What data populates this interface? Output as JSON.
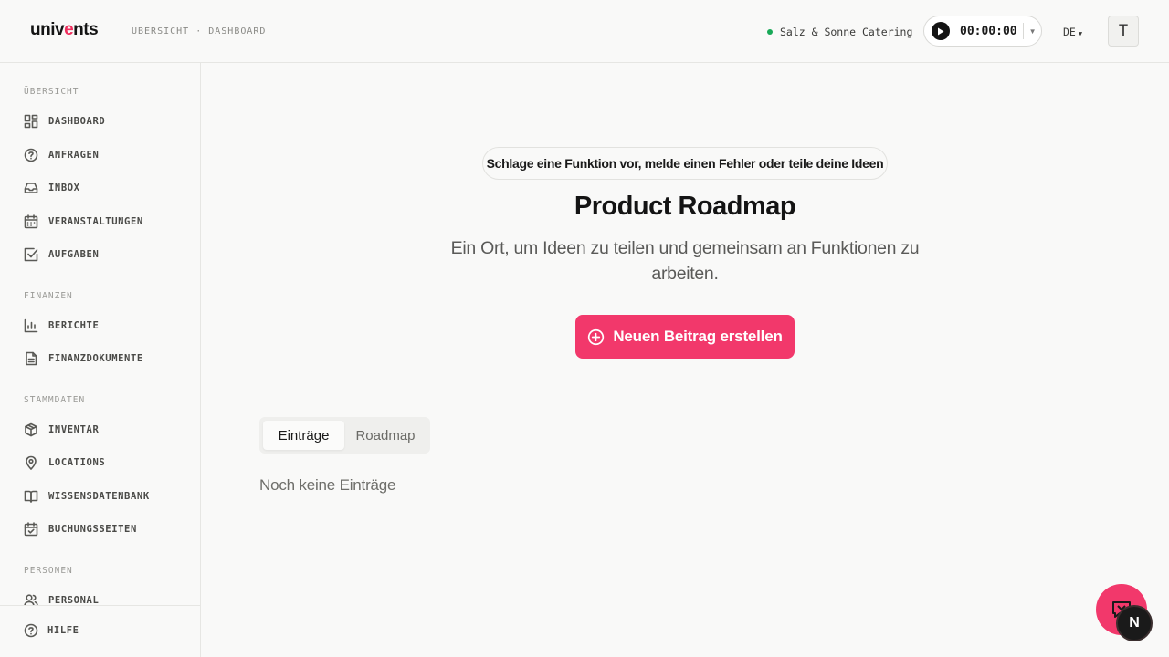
{
  "header": {
    "logo_pre": "univ",
    "logo_accent": "e",
    "logo_post": "nts",
    "breadcrumb": "ÜBERSICHT · DASHBOARD",
    "company": "Salz & Sonne Catering",
    "timer": "00:00:00",
    "language": "DE",
    "avatar_initial": "T"
  },
  "sidebar": {
    "sections": [
      {
        "label": "ÜBERSICHT",
        "items": [
          "DASHBOARD",
          "ANFRAGEN",
          "INBOX",
          "VERANSTALTUNGEN",
          "AUFGABEN"
        ]
      },
      {
        "label": "FINANZEN",
        "items": [
          "BERICHTE",
          "FINANZDOKUMENTE"
        ]
      },
      {
        "label": "STAMMDATEN",
        "items": [
          "INVENTAR",
          "LOCATIONS",
          "WISSENSDATENBANK",
          "BUCHUNGSSEITEN"
        ]
      },
      {
        "label": "PERSONEN",
        "items": [
          "PERSONAL"
        ]
      }
    ],
    "help_label": "HILFE"
  },
  "main": {
    "pill_text": "Schlage eine Funktion vor, melde einen Fehler oder teile deine Ideen",
    "title": "Product Roadmap",
    "subtitle": "Ein Ort, um Ideen zu teilen und gemeinsam an Funktionen zu arbeiten.",
    "cta_label": "Neuen Beitrag erstellen",
    "tabs": [
      {
        "label": "Einträge",
        "active": true
      },
      {
        "label": "Roadmap",
        "active": false
      }
    ],
    "empty_text": "Noch keine Einträge"
  },
  "floating": {
    "badge_letter": "N"
  },
  "colors": {
    "accent": "#f2386b",
    "status": "#18a957",
    "text": "#141414"
  },
  "icons": {
    "sidebar": [
      "dashboard-icon",
      "help-circle-icon",
      "inbox-icon",
      "calendar-icon",
      "checkbox-icon",
      "bar-chart-icon",
      "document-icon",
      "box-icon",
      "map-pin-icon",
      "book-icon",
      "calendar-check-icon",
      "users-icon"
    ]
  }
}
